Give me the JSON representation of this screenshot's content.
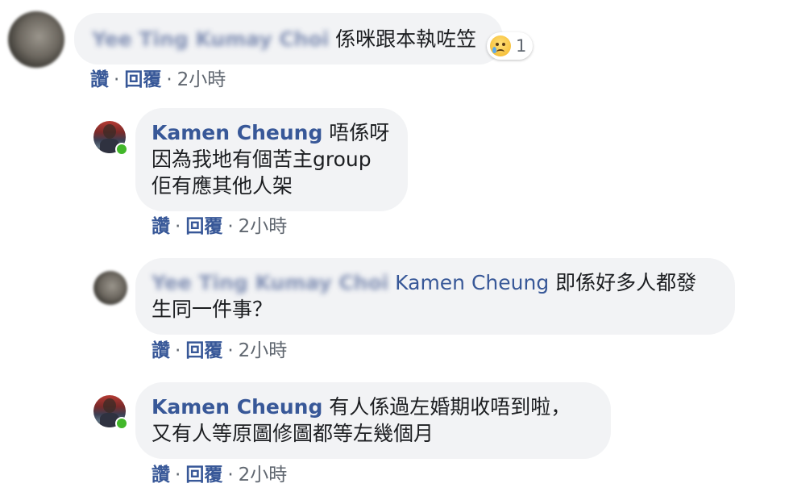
{
  "comments": [
    {
      "author": "Yee Ting Kumay Choi",
      "text": "係咪跟本執咗笠",
      "reaction": {
        "icon": "sad-face-icon",
        "count": "1"
      },
      "actions": {
        "like": "讚",
        "reply": "回覆",
        "time": "2小時"
      }
    },
    {
      "author": "Kamen Cheung",
      "text_lines": [
        "唔係呀",
        "因為我地有個苦主group",
        "佢有應其他人架"
      ],
      "actions": {
        "like": "讚",
        "reply": "回覆",
        "time": "2小時"
      }
    },
    {
      "author": "Yee Ting Kumay Choi",
      "mention": "Kamen Cheung",
      "text_lines": [
        "即係好多人都發",
        "生同一件事？"
      ],
      "actions": {
        "like": "讚",
        "reply": "回覆",
        "time": "2小時"
      }
    },
    {
      "author": "Kamen Cheung",
      "text_lines": [
        "有人係過左婚期收唔到啦，",
        "又有人等原圖修圖都等左幾個月"
      ],
      "actions": {
        "like": "讚",
        "reply": "回覆",
        "time": "2小時"
      }
    }
  ],
  "colors": {
    "link": "#385898",
    "bubble": "#f2f3f5",
    "online": "#42b72a",
    "meta": "#606770"
  }
}
